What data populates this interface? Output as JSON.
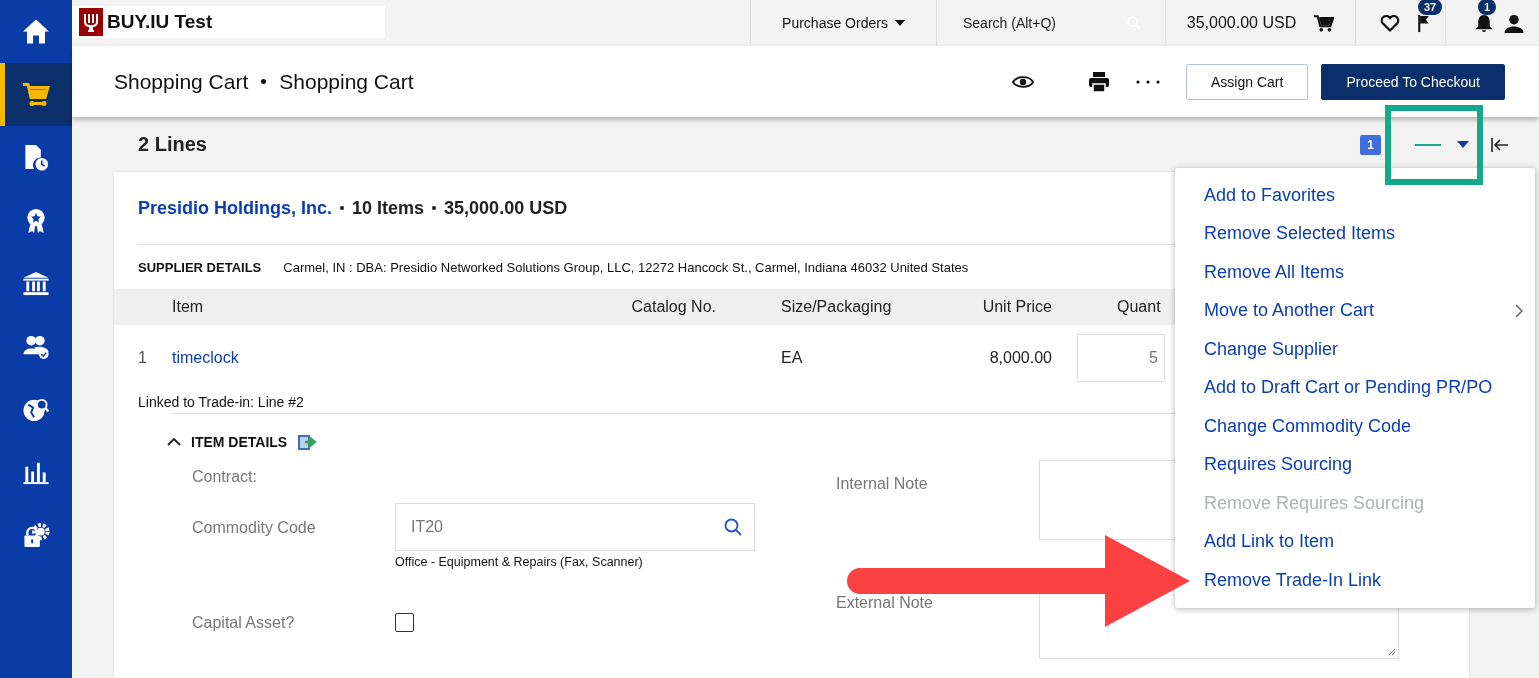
{
  "topbar": {
    "logo": "BUY.IU Test",
    "menu": "Purchase Orders",
    "search": {
      "placeholder": "Search (Alt+Q)"
    },
    "cart_total": "35,000.00 USD",
    "flags_count": "37",
    "notifications_count": "1"
  },
  "sidebar": {
    "items": [
      {
        "kind": "home",
        "selected": false
      },
      {
        "kind": "cart",
        "selected": true
      },
      {
        "kind": "documents",
        "selected": false
      },
      {
        "kind": "award",
        "selected": false
      },
      {
        "kind": "bank",
        "selected": false
      },
      {
        "kind": "people",
        "selected": false
      },
      {
        "kind": "globe",
        "selected": false
      },
      {
        "kind": "chart",
        "selected": false
      },
      {
        "kind": "lock",
        "selected": false
      }
    ]
  },
  "header": {
    "breadcrumb": [
      "Shopping Cart",
      "Shopping Cart"
    ],
    "buttons": [
      {
        "label": "Assign Cart",
        "kind": "secondary"
      },
      {
        "label": "Proceed To Checkout",
        "kind": "primary"
      }
    ]
  },
  "toolbar": {
    "title": "2 Lines",
    "selected_count": "1"
  },
  "supplier": {
    "name": "Presidio Holdings, Inc.",
    "items": "10 Items",
    "total": "35,000.00 USD",
    "details_label": "SUPPLIER DETAILS",
    "details": "Carmel, IN : DBA: Presidio Networked Solutions Group, LLC, 12272 Hancock St., Carmel, Indiana 46032 United States"
  },
  "table": {
    "columns": [
      "Item",
      "Catalog No.",
      "Size/Packaging",
      "Unit Price",
      "Quant"
    ],
    "rows": [
      {
        "line": "1",
        "item": "timeclock",
        "size": "EA",
        "unit_price": "8,000.00",
        "quantity": "5"
      }
    ]
  },
  "linked_note": "Linked to Trade-in: Line #2",
  "item_details": {
    "title": "ITEM DETAILS",
    "expanded": true,
    "contract_label": "Contract:",
    "commodity_label": "Commodity Code",
    "commodity_value": "IT20",
    "commodity_hint": "Office - Equipment & Repairs (Fax, Scanner)",
    "capital_label": "Capital Asset?",
    "capital_checked": false,
    "internal_note_label": "Internal Note",
    "external_note_label": "External Note"
  },
  "menu": {
    "items": [
      {
        "label": "Add to Favorites",
        "disabled": false,
        "submenu": false
      },
      {
        "label": "Remove Selected Items",
        "disabled": false,
        "submenu": false
      },
      {
        "label": "Remove All Items",
        "disabled": false,
        "submenu": false
      },
      {
        "label": "Move to Another Cart",
        "disabled": false,
        "submenu": true
      },
      {
        "label": "Change Supplier",
        "disabled": false,
        "submenu": false
      },
      {
        "label": "Add to Draft Cart or Pending PR/PO",
        "disabled": false,
        "submenu": false
      },
      {
        "label": "Change Commodity Code",
        "disabled": false,
        "submenu": false
      },
      {
        "label": "Requires Sourcing",
        "disabled": false,
        "submenu": false
      },
      {
        "label": "Remove Requires Sourcing",
        "disabled": true,
        "submenu": false
      },
      {
        "label": "Add Link to Item",
        "disabled": false,
        "submenu": false
      },
      {
        "label": "Remove Trade-In Link",
        "disabled": false,
        "submenu": false
      }
    ]
  }
}
